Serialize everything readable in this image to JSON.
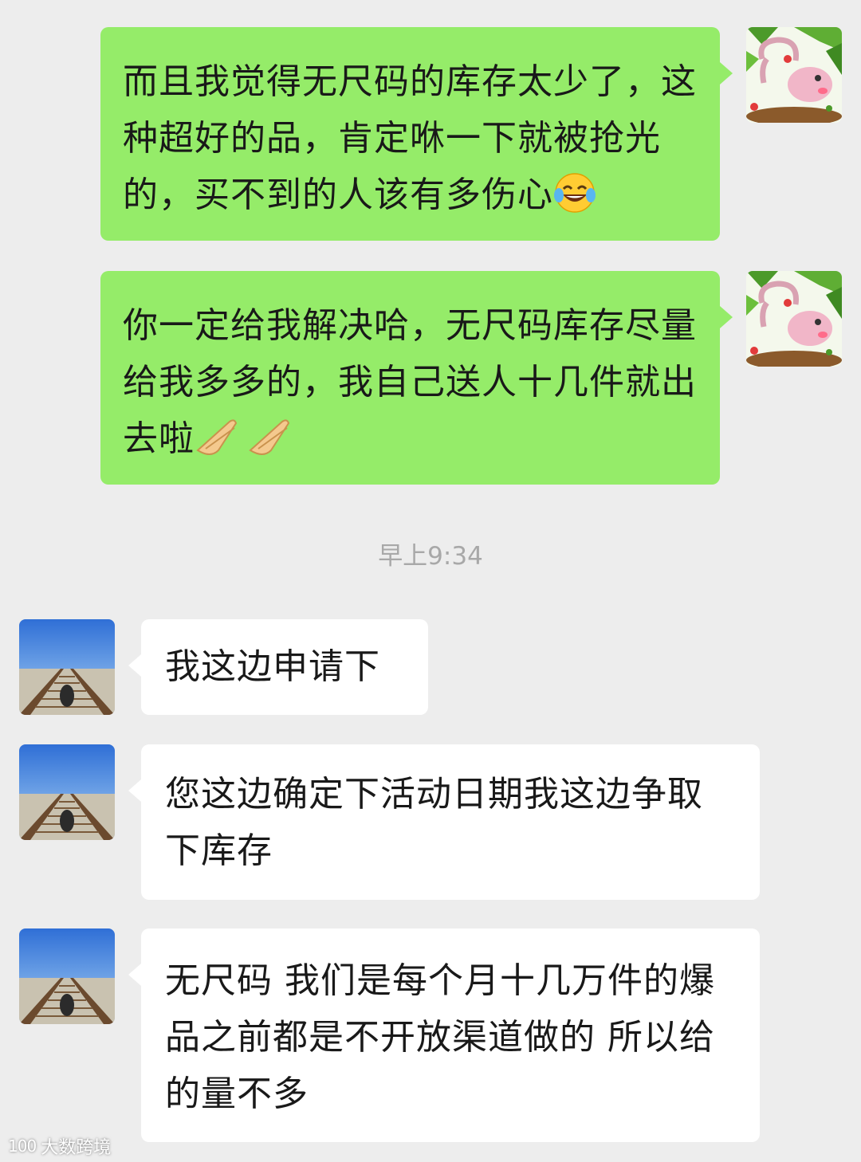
{
  "messages": [
    {
      "direction": "sent",
      "text": "而且我觉得无尺码的库存太少了，这种超好的品，肯定咻一下就被抢光的，买不到的人该有多伤心",
      "trailing_emoji": "tears-of-joy-emoji"
    },
    {
      "direction": "sent",
      "text": "你一定给我解决哈，无尺码库存尽量给我多多的，我自己送人十几件就出去啦",
      "trailing_emoji": "praying-hands-emoji x2"
    },
    {
      "direction": "received",
      "text": "我这边申请下"
    },
    {
      "direction": "received",
      "text": "您这边确定下活动日期我这边争取下库存"
    },
    {
      "direction": "received",
      "text": "无尺码 我们是每个月十几万件的爆品之前都是不开放渠道做的 所以给的量不多"
    }
  ],
  "timestamp": "早上9:34",
  "watermark": {
    "logo": "100",
    "text": "大数跨境"
  },
  "colors": {
    "background": "#ededed",
    "sent_bubble": "#95ec69",
    "received_bubble": "#ffffff",
    "timestamp_text": "#a8a8a8"
  }
}
